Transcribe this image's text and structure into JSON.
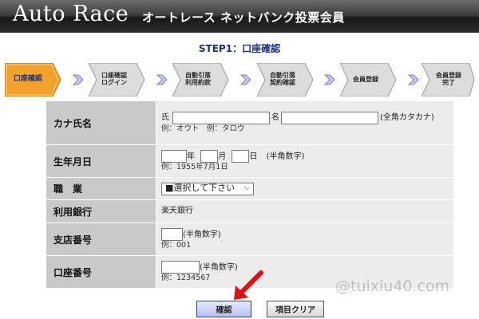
{
  "header": {
    "logo": "Auto Race",
    "title": "オートレース ネットバンク投票会員"
  },
  "step_title": "STEP1：口座確認",
  "steps": [
    {
      "line1": "口座確認",
      "line2": "",
      "active": true
    },
    {
      "line1": "口座確認",
      "line2": "ログイン",
      "active": false
    },
    {
      "line1": "自動引落",
      "line2": "利用約款",
      "active": false
    },
    {
      "line1": "自動引落",
      "line2": "契約確認",
      "active": false
    },
    {
      "line1": "会員登録",
      "line2": "",
      "active": false
    },
    {
      "line1": "会員登録",
      "line2": "完了",
      "active": false
    }
  ],
  "form": {
    "kana_name": {
      "label": "カナ氏名",
      "sei": "氏",
      "mei": "名",
      "note": "(全角カタカナ)",
      "example": "例：オウト　例：タロウ",
      "sei_value": "",
      "mei_value": ""
    },
    "birthdate": {
      "label": "生年月日",
      "year": "年",
      "month": "月",
      "day": "日",
      "note": "(半角数字)",
      "example": "例：1955年7月1日"
    },
    "occupation": {
      "label": "職　業",
      "selected": "■選択して下さい"
    },
    "bank": {
      "label": "利用銀行",
      "value": "楽天銀行"
    },
    "branch": {
      "label": "支店番号",
      "note": "(半角数字)",
      "example": "例：001",
      "value": ""
    },
    "account": {
      "label": "口座番号",
      "note": "(半角数字)",
      "example": "例：1234567",
      "value": ""
    }
  },
  "buttons": {
    "confirm": "確認",
    "clear": "項目クリア"
  },
  "watermark": "@tuixiu40.com",
  "colors": {
    "active_step": "#f2a12b",
    "inactive_step": "#dcdcdc",
    "arrow_annotation": "#e01010",
    "step_title": "#1a2f7a"
  }
}
